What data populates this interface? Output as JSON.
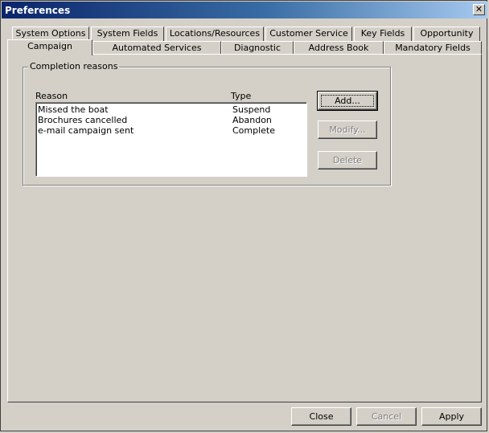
{
  "window": {
    "title": "Preferences",
    "close_glyph": "✕"
  },
  "tabs_back": [
    {
      "label": "System Options"
    },
    {
      "label": "System Fields"
    },
    {
      "label": "Locations/Resources"
    },
    {
      "label": "Customer Service"
    },
    {
      "label": "Key Fields"
    },
    {
      "label": "Opportunity"
    }
  ],
  "tabs_front": [
    {
      "label": "Campaign",
      "active": true
    },
    {
      "label": "Automated Services"
    },
    {
      "label": "Diagnostic"
    },
    {
      "label": "Address Book"
    },
    {
      "label": "Mandatory Fields"
    }
  ],
  "completion": {
    "group_label": "Completion reasons",
    "columns": {
      "reason": "Reason",
      "type": "Type"
    },
    "rows": [
      {
        "reason": "Missed the boat",
        "type": "Suspend"
      },
      {
        "reason": "Brochures cancelled",
        "type": "Abandon"
      },
      {
        "reason": "e-mail campaign sent",
        "type": "Complete"
      }
    ],
    "buttons": {
      "add": "Add...",
      "modify": "Modify...",
      "delete": "Delete"
    }
  },
  "footer": {
    "close": "Close",
    "cancel": "Cancel",
    "apply": "Apply"
  }
}
